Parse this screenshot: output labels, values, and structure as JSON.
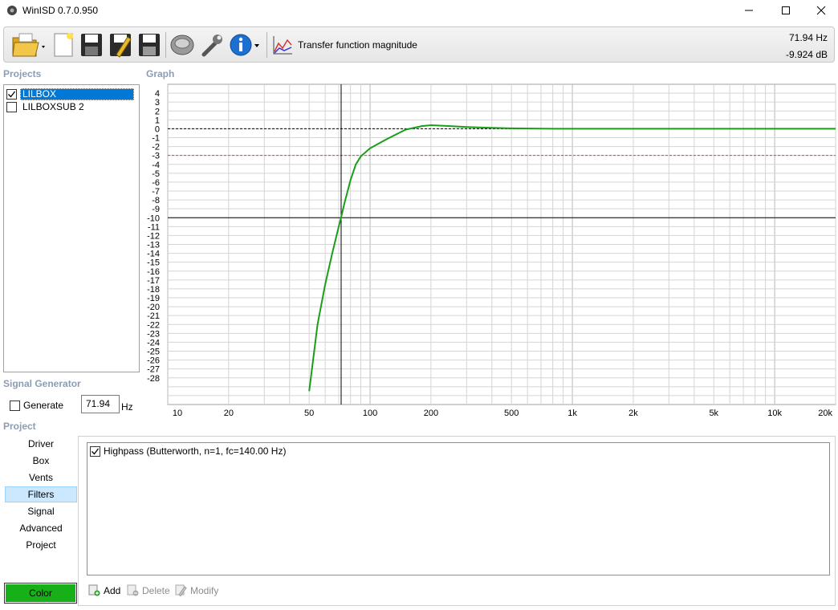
{
  "window": {
    "title": "WinISD 0.7.0.950"
  },
  "toolbar": {
    "graph_label": "Transfer function magnitude",
    "readout_freq": "71.94 Hz",
    "readout_db": "-9.924 dB"
  },
  "projects": {
    "label": "Projects",
    "items": [
      {
        "name": "LILBOX",
        "checked": true,
        "selected": true
      },
      {
        "name": "LILBOXSUB 2",
        "checked": false,
        "selected": false
      }
    ]
  },
  "graph": {
    "label": "Graph",
    "y_ticks": [
      "4",
      "3",
      "2",
      "1",
      "0",
      "-1",
      "-2",
      "-3",
      "-4",
      "-5",
      "-6",
      "-7",
      "-8",
      "-9",
      "-10",
      "-11",
      "-12",
      "-13",
      "-14",
      "-15",
      "-16",
      "-17",
      "-18",
      "-19",
      "-20",
      "-21",
      "-22",
      "-23",
      "-24",
      "-25",
      "-26",
      "-27",
      "-28"
    ],
    "x_ticks": [
      "10",
      "20",
      "50",
      "100",
      "200",
      "500",
      "1k",
      "2k",
      "5k",
      "10k",
      "20k"
    ],
    "colors": {
      "curve": "#1a9e1a",
      "zero_line": "#000000",
      "minus3_line": "#e04040",
      "grid": "#c8c8c8"
    }
  },
  "chart_data": {
    "type": "line",
    "title": "Transfer function magnitude",
    "xlabel": "",
    "ylabel": "",
    "x_scale": "log",
    "xlim": [
      10,
      20000
    ],
    "ylim": [
      -28,
      4
    ],
    "cursor": {
      "x": 71.94,
      "y": -9.924
    },
    "reference_lines": [
      0,
      -3
    ],
    "series": [
      {
        "x": [
          50,
          55,
          60,
          65,
          70,
          72,
          75,
          80,
          85,
          90,
          100,
          120,
          150,
          180,
          200,
          250,
          300,
          400,
          500,
          800,
          1000,
          20000
        ],
        "values": [
          -29.5,
          -22.0,
          -17.5,
          -14.0,
          -11.0,
          -9.9,
          -8.2,
          -5.8,
          -4.0,
          -3.1,
          -2.2,
          -1.2,
          -0.1,
          0.3,
          0.4,
          0.3,
          0.2,
          0.1,
          0.05,
          0.0,
          0.0,
          0.0
        ]
      }
    ]
  },
  "signal_generator": {
    "label": "Signal Generator",
    "generate_label": "Generate",
    "generate_checked": false,
    "frequency_value": "71.94",
    "unit": "Hz"
  },
  "project_nav": {
    "label": "Project",
    "items": [
      "Driver",
      "Box",
      "Vents",
      "Filters",
      "Signal",
      "Advanced",
      "Project"
    ],
    "active": "Filters",
    "color_button": "Color"
  },
  "filters": {
    "items": [
      {
        "text": "Highpass (Butterworth, n=1, fc=140.00 Hz)",
        "checked": true
      }
    ],
    "buttons": {
      "add": "Add",
      "delete": "Delete",
      "modify": "Modify"
    }
  }
}
